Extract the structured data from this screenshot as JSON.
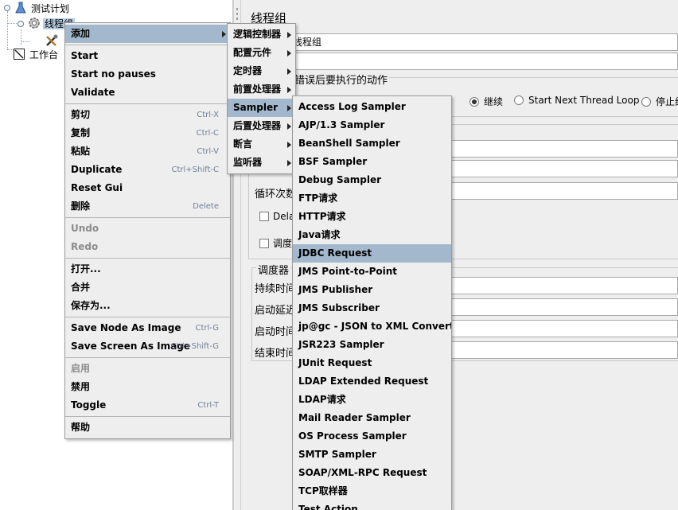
{
  "tree": {
    "test_plan": "测试计划",
    "thread_group": "线程组",
    "workbench": "工作台"
  },
  "panel": {
    "title": "线程组",
    "name_value": "线程组",
    "on_error_section": "错误后要执行的动作",
    "radio_continue": "继续",
    "radio_next_loop": "Start Next Thread Loop",
    "radio_stop": "停止线",
    "loop_count_label": "循环次数",
    "delay_label": "Dela",
    "scheduler_label": "调度",
    "scheduler_section": "调度器",
    "duration_label": "持续时间",
    "startup_delay_label": "启动延迟",
    "start_time_label": "启动时间",
    "end_time_label": "结束时间"
  },
  "context_menu": {
    "items": [
      {
        "label": "添加",
        "shortcut": "",
        "submenu": true,
        "highlight": true,
        "disabled": false
      },
      {
        "sep": true
      },
      {
        "label": "Start",
        "shortcut": "",
        "disabled": false
      },
      {
        "label": "Start no pauses",
        "shortcut": "",
        "disabled": false
      },
      {
        "label": "Validate",
        "shortcut": "",
        "disabled": false
      },
      {
        "sep": true
      },
      {
        "label": "剪切",
        "shortcut": "Ctrl-X",
        "disabled": false
      },
      {
        "label": "复制",
        "shortcut": "Ctrl-C",
        "disabled": false
      },
      {
        "label": "粘贴",
        "shortcut": "Ctrl-V",
        "disabled": false
      },
      {
        "label": "Duplicate",
        "shortcut": "Ctrl+Shift-C",
        "disabled": false
      },
      {
        "label": "Reset Gui",
        "shortcut": "",
        "disabled": false
      },
      {
        "label": "删除",
        "shortcut": "Delete",
        "disabled": false
      },
      {
        "sep": true
      },
      {
        "label": "Undo",
        "shortcut": "",
        "disabled": true
      },
      {
        "label": "Redo",
        "shortcut": "",
        "disabled": true
      },
      {
        "sep": true
      },
      {
        "label": "打开...",
        "shortcut": "",
        "disabled": false
      },
      {
        "label": "合并",
        "shortcut": "",
        "disabled": false
      },
      {
        "label": "保存为...",
        "shortcut": "",
        "disabled": false
      },
      {
        "sep": true
      },
      {
        "label": "Save Node As Image",
        "shortcut": "Ctrl-G",
        "disabled": false
      },
      {
        "label": "Save Screen As Image",
        "shortcut": "Ctrl+Shift-G",
        "disabled": false
      },
      {
        "sep": true
      },
      {
        "label": "启用",
        "shortcut": "",
        "disabled": true
      },
      {
        "label": "禁用",
        "shortcut": "",
        "disabled": false
      },
      {
        "label": "Toggle",
        "shortcut": "Ctrl-T",
        "disabled": false
      },
      {
        "sep": true
      },
      {
        "label": "帮助",
        "shortcut": "",
        "disabled": false
      }
    ]
  },
  "add_menu": {
    "items": [
      {
        "label": "逻辑控制器",
        "submenu": true
      },
      {
        "label": "配置元件",
        "submenu": true
      },
      {
        "label": "定时器",
        "submenu": true
      },
      {
        "label": "前置处理器",
        "submenu": true
      },
      {
        "label": "Sampler",
        "submenu": true,
        "highlight": true
      },
      {
        "label": "后置处理器",
        "submenu": true
      },
      {
        "label": "断言",
        "submenu": true
      },
      {
        "label": "监听器",
        "submenu": true
      }
    ]
  },
  "sampler_menu": {
    "items": [
      {
        "label": "Access Log Sampler"
      },
      {
        "label": "AJP/1.3 Sampler"
      },
      {
        "label": "BeanShell Sampler"
      },
      {
        "label": "BSF Sampler"
      },
      {
        "label": "Debug Sampler"
      },
      {
        "label": "FTP请求"
      },
      {
        "label": "HTTP请求"
      },
      {
        "label": "Java请求"
      },
      {
        "label": "JDBC Request",
        "highlight": true
      },
      {
        "label": "JMS Point-to-Point"
      },
      {
        "label": "JMS Publisher"
      },
      {
        "label": "JMS Subscriber"
      },
      {
        "label": "jp@gc - JSON to XML Converter"
      },
      {
        "label": "JSR223 Sampler"
      },
      {
        "label": "JUnit Request"
      },
      {
        "label": "LDAP Extended Request"
      },
      {
        "label": "LDAP请求"
      },
      {
        "label": "Mail Reader Sampler"
      },
      {
        "label": "OS Process Sampler"
      },
      {
        "label": "SMTP Sampler"
      },
      {
        "label": "SOAP/XML-RPC Request"
      },
      {
        "label": "TCP取样器"
      },
      {
        "label": "Test Action"
      }
    ]
  },
  "colors": {
    "menu_highlight": "#a3b8cc",
    "tree_selection": "#b8cfe5",
    "shortcut_text": "#6f7f99"
  }
}
